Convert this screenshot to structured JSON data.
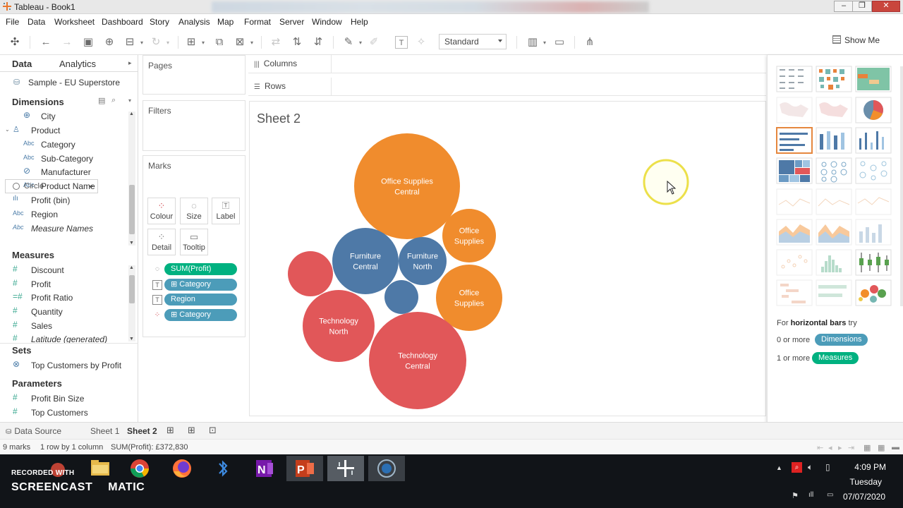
{
  "window": {
    "title": "Tableau - Book1"
  },
  "menu": [
    "File",
    "Data",
    "Worksheet",
    "Dashboard",
    "Story",
    "Analysis",
    "Map",
    "Format",
    "Server",
    "Window",
    "Help"
  ],
  "toolbar": {
    "fit_mode": "Standard",
    "show_me_label": "Show Me"
  },
  "left_panel": {
    "tabs": [
      "Data",
      "Analytics"
    ],
    "datasource": "Sample - EU Superstore",
    "dimensions_label": "Dimensions",
    "dimensions": [
      {
        "label": "City",
        "icon": "globe-icon"
      },
      {
        "label": "Product",
        "icon": "hierarchy-icon"
      },
      {
        "label": "Category",
        "icon": "abc-icon"
      },
      {
        "label": "Sub-Category",
        "icon": "abc-icon"
      },
      {
        "label": "Manufacturer",
        "icon": "link-icon"
      },
      {
        "label": "Product Name",
        "icon": "abc-icon"
      },
      {
        "label": "Profit (bin)",
        "icon": "bin-icon"
      },
      {
        "label": "Region",
        "icon": "abc-icon"
      },
      {
        "label": "Measure Names",
        "icon": "abc-icon"
      }
    ],
    "measures_label": "Measures",
    "measures": [
      {
        "label": "Discount"
      },
      {
        "label": "Profit"
      },
      {
        "label": "Profit Ratio"
      },
      {
        "label": "Quantity"
      },
      {
        "label": "Sales"
      },
      {
        "label": "Latitude (generated)"
      }
    ],
    "sets_label": "Sets",
    "sets": [
      {
        "label": "Top Customers by Profit"
      }
    ],
    "parameters_label": "Parameters",
    "parameters": [
      {
        "label": "Profit Bin Size"
      },
      {
        "label": "Top Customers"
      }
    ]
  },
  "shelves": {
    "pages": "Pages",
    "filters": "Filters",
    "marks": "Marks",
    "mark_type": "Circle",
    "buttons": [
      "Colour",
      "Size",
      "Label",
      "Detail",
      "Tooltip"
    ],
    "pills": [
      {
        "label": "SUM(Profit)",
        "color": "#00b180",
        "icon": "size-icon"
      },
      {
        "label": "⊞ Category",
        "color": "#4c9cb9",
        "icon": "label-icon"
      },
      {
        "label": "Region",
        "color": "#4c9cb9",
        "icon": "label-icon"
      },
      {
        "label": "⊞ Category",
        "color": "#4c9cb9",
        "icon": "colour-icon"
      }
    ],
    "columns": "Columns",
    "rows": "Rows"
  },
  "view": {
    "sheet_title": "Sheet 2"
  },
  "chart_data": {
    "type": "packed-bubble",
    "size_measure": "SUM(Profit)",
    "color_by": "Category",
    "label_fields": [
      "Category",
      "Region"
    ],
    "color_legend": {
      "Office Supplies": "#f08c2d",
      "Furniture": "#4e79a7",
      "Technology": "#e15759"
    },
    "bubbles": [
      {
        "category": "Office Supplies",
        "region": "Central",
        "label_lines": [
          "Office Supplies",
          "Central"
        ],
        "relative_size": 75
      },
      {
        "category": "Office Supplies",
        "region": "North",
        "label_lines": [
          "Office",
          "Supplies"
        ],
        "relative_size": 38
      },
      {
        "category": "Office Supplies",
        "region": "South",
        "label_lines": [
          "Office",
          "Supplies"
        ],
        "relative_size": 47
      },
      {
        "category": "Furniture",
        "region": "Central",
        "label_lines": [
          "Furniture",
          "Central"
        ],
        "relative_size": 47
      },
      {
        "category": "Furniture",
        "region": "North",
        "label_lines": [
          "Furniture",
          "North"
        ],
        "relative_size": 34
      },
      {
        "category": "Furniture",
        "region": "South",
        "label_lines": [],
        "relative_size": 24
      },
      {
        "category": "Technology",
        "region": "Central",
        "label_lines": [
          "Technology",
          "Central"
        ],
        "relative_size": 69
      },
      {
        "category": "Technology",
        "region": "North",
        "label_lines": [
          "Technology",
          "North"
        ],
        "relative_size": 51
      },
      {
        "category": "Technology",
        "region": "South",
        "label_lines": [],
        "relative_size": 32
      }
    ]
  },
  "show_me": {
    "hint_prefix": "For",
    "hint_bold": "horizontal bars",
    "hint_suffix": "try",
    "req1_prefix": "0 or more",
    "req1_pill": "Dimensions",
    "req2_prefix": "1 or more",
    "req2_pill": "Measures",
    "pill_dim_color": "#4c9cb9",
    "pill_meas_color": "#00b180"
  },
  "sheet_tabs": {
    "data_source": "Data Source",
    "tabs": [
      "Sheet 1",
      "Sheet 2"
    ],
    "active": "Sheet 2"
  },
  "status": {
    "marks": "9 marks",
    "grid": "1 row by 1 column",
    "sum": "SUM(Profit): £372,830"
  },
  "taskbar": {
    "watermark_line1": "RECORDED WITH",
    "watermark_line2": "SCREENCAST",
    "watermark_line3": "MATIC",
    "time": "4:09 PM",
    "day": "Tuesday",
    "date": "07/07/2020"
  }
}
